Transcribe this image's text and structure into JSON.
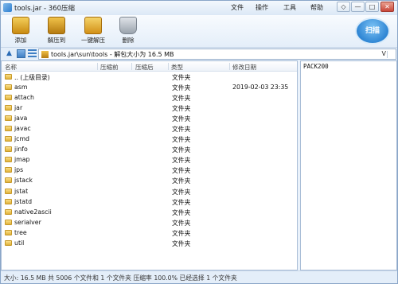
{
  "window": {
    "title": "tools.jar - 360压缩",
    "menus": [
      "文件",
      "操作",
      "工具",
      "帮助"
    ],
    "controls": {
      "skin": "◇",
      "minimize": "—",
      "maximize": "□",
      "close": "✕"
    }
  },
  "toolbar": {
    "buttons": [
      {
        "label": "添加",
        "icon": "add-archive-icon"
      },
      {
        "label": "解压到",
        "icon": "extract-to-icon"
      },
      {
        "label": "一键解压",
        "icon": "one-click-extract-icon"
      },
      {
        "label": "删除",
        "icon": "trash-icon"
      }
    ],
    "scan_label": "扫描"
  },
  "addressbar": {
    "path": "tools.jar\\sun\\tools - 解包大小为 16.5 MB",
    "dropdown": "V",
    "up_glyph": "▲"
  },
  "columns": [
    "名称",
    "压缩前",
    "压缩后",
    "类型",
    "修改日期"
  ],
  "rows": [
    {
      "name": ".. (上级目录)",
      "type": "文件夹",
      "date": ""
    },
    {
      "name": "asm",
      "type": "文件夹",
      "date": "2019-02-03 23:35"
    },
    {
      "name": "attach",
      "type": "文件夹",
      "date": ""
    },
    {
      "name": "jar",
      "type": "文件夹",
      "date": ""
    },
    {
      "name": "java",
      "type": "文件夹",
      "date": ""
    },
    {
      "name": "javac",
      "type": "文件夹",
      "date": ""
    },
    {
      "name": "jcmd",
      "type": "文件夹",
      "date": ""
    },
    {
      "name": "jinfo",
      "type": "文件夹",
      "date": ""
    },
    {
      "name": "jmap",
      "type": "文件夹",
      "date": ""
    },
    {
      "name": "jps",
      "type": "文件夹",
      "date": ""
    },
    {
      "name": "jstack",
      "type": "文件夹",
      "date": ""
    },
    {
      "name": "jstat",
      "type": "文件夹",
      "date": ""
    },
    {
      "name": "jstatd",
      "type": "文件夹",
      "date": ""
    },
    {
      "name": "native2ascii",
      "type": "文件夹",
      "date": ""
    },
    {
      "name": "serialver",
      "type": "文件夹",
      "date": ""
    },
    {
      "name": "tree",
      "type": "文件夹",
      "date": ""
    },
    {
      "name": "util",
      "type": "文件夹",
      "date": ""
    }
  ],
  "comment_text": "PACK200",
  "status": "大小: 16.5 MB 共 5006 个文件和 1 个文件夹 压缩率 100.0% 已经选择 1 个文件夹",
  "colors": {
    "accent": "#2f86d4",
    "folder": "#e0b23a",
    "chrome": "#e4eef9"
  }
}
